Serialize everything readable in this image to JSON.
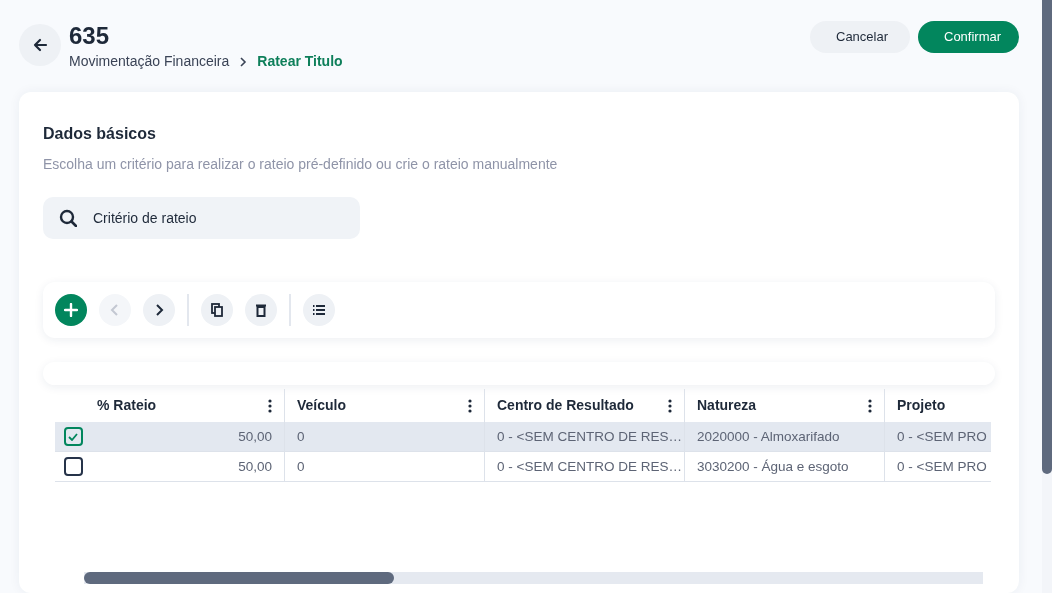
{
  "header": {
    "title": "635",
    "breadcrumb": [
      {
        "label": "Movimentação Financeira",
        "current": false
      },
      {
        "label": "Ratear Titulo",
        "current": true
      }
    ]
  },
  "actions": [
    {
      "label": "Cancelar",
      "kind": "secondary"
    },
    {
      "label": "Confirmar",
      "kind": "primary"
    }
  ],
  "section": {
    "title": "Dados básicos",
    "subtitle": "Escolha um critério para realizar o rateio pré-definido ou crie o rateio manualmente",
    "search": {
      "placeholder": "Critério de rateio"
    }
  },
  "toolbar": [
    {
      "kind": "add",
      "disabled": false
    },
    {
      "kind": "previous",
      "disabled": true
    },
    {
      "kind": "next",
      "disabled": false
    },
    {
      "kind": "separator"
    },
    {
      "kind": "copy",
      "disabled": false
    },
    {
      "kind": "delete",
      "disabled": false
    },
    {
      "kind": "separator"
    },
    {
      "kind": "columns",
      "disabled": false
    }
  ],
  "table": {
    "columns": [
      {
        "label": "% Rateio",
        "menu": true
      },
      {
        "label": "Veículo",
        "menu": true
      },
      {
        "label": "Centro de Resultado",
        "menu": true
      },
      {
        "label": "Natureza",
        "menu": true
      },
      {
        "label": "Projeto",
        "menu": false
      }
    ],
    "rows": [
      {
        "selected": true,
        "checked": true,
        "cells": [
          "50,00",
          "0",
          "0 - <SEM CENTRO DE RES…",
          "2020000 - Almoxarifado",
          "0 - <SEM PRO"
        ]
      },
      {
        "selected": false,
        "checked": false,
        "cells": [
          "50,00",
          "0",
          "0 - <SEM CENTRO DE RES…",
          "3030200 - Água e esgoto",
          "0 - <SEM PRO"
        ]
      }
    ]
  }
}
